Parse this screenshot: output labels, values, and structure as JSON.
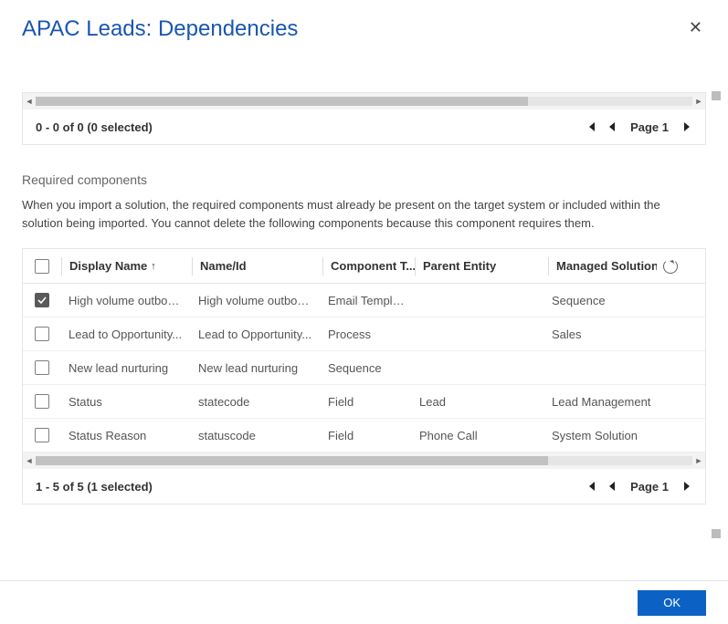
{
  "dialog": {
    "title": "APAC Leads: Dependencies"
  },
  "top_pager": {
    "status": "0 - 0 of 0 (0 selected)",
    "page_label": "Page 1"
  },
  "section": {
    "title": "Required components",
    "description": "When you import a solution, the required components must already be present on the target system or included within the solution being imported. You cannot delete the following components because this component requires them."
  },
  "columns": {
    "display_name": "Display Name",
    "name_id": "Name/Id",
    "component_type": "Component T...",
    "parent_entity": "Parent Entity",
    "managed_solution": "Managed Solution"
  },
  "rows": [
    {
      "checked": true,
      "display": "High volume outbou...",
      "name": "High volume outbou...",
      "type": "Email Template",
      "parent": "",
      "managed": "Sequence"
    },
    {
      "checked": false,
      "display": "Lead to Opportunity...",
      "name": "Lead to Opportunity...",
      "type": "Process",
      "parent": "",
      "managed": "Sales"
    },
    {
      "checked": false,
      "display": "New lead nurturing",
      "name": "New lead nurturing",
      "type": "Sequence",
      "parent": "",
      "managed": ""
    },
    {
      "checked": false,
      "display": "Status",
      "name": "statecode",
      "type": "Field",
      "parent": "Lead",
      "managed": "Lead Management"
    },
    {
      "checked": false,
      "display": "Status Reason",
      "name": "statuscode",
      "type": "Field",
      "parent": "Phone Call",
      "managed": "System Solution"
    }
  ],
  "bottom_pager": {
    "status": "1 - 5 of 5 (1 selected)",
    "page_label": "Page 1"
  },
  "footer": {
    "ok": "OK"
  }
}
